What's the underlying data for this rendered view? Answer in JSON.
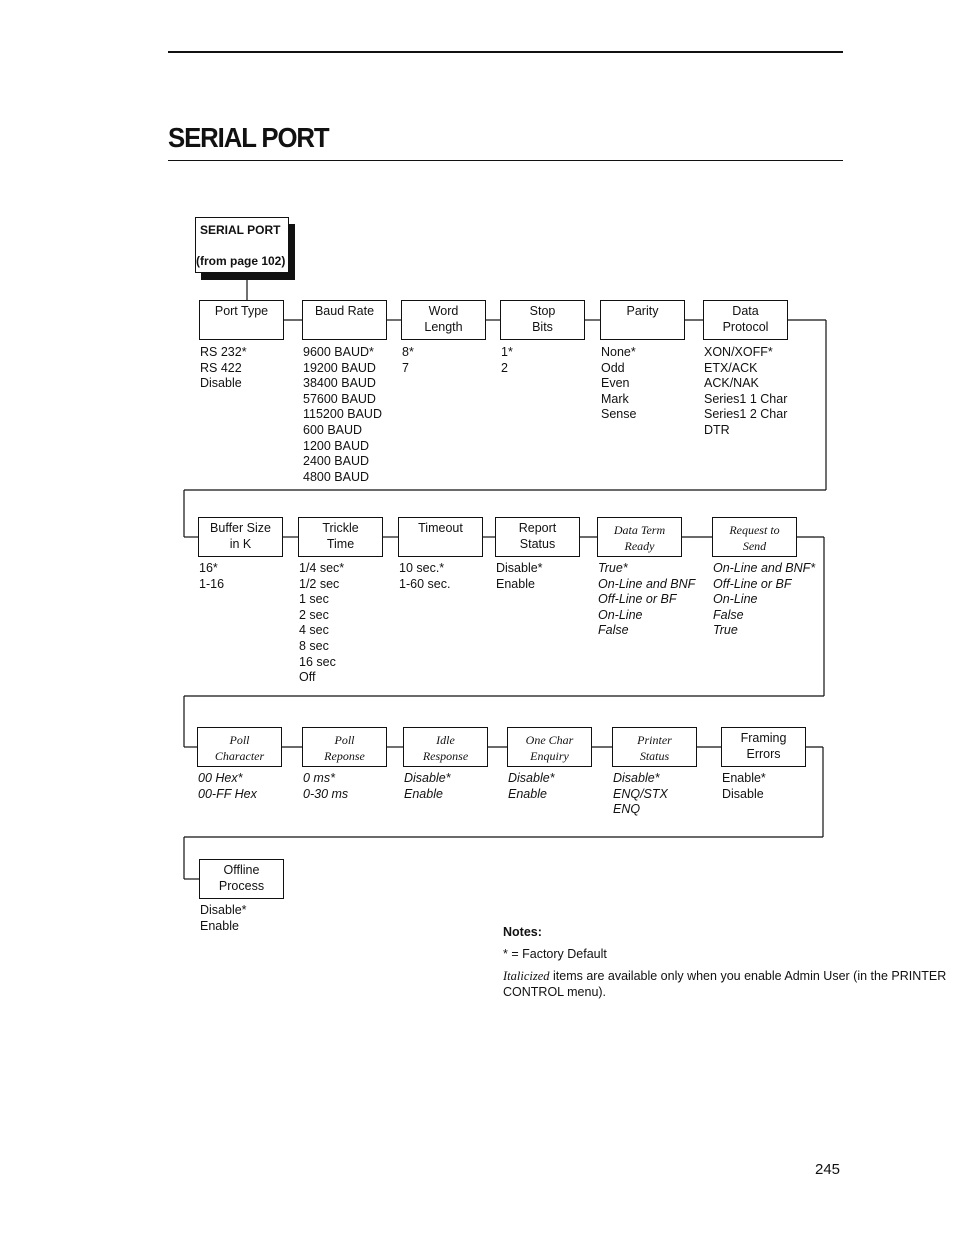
{
  "page": {
    "title": "SERIAL PORT",
    "page_number": "245"
  },
  "root": {
    "title": "SERIAL PORT",
    "subtitle": "(from page 102)"
  },
  "rows": [
    {
      "items": [
        {
          "label": [
            "Port Type"
          ],
          "italic": false,
          "options": [
            "RS 232*",
            "RS 422",
            "Disable"
          ],
          "options_italic": false
        },
        {
          "label": [
            "Baud Rate"
          ],
          "italic": false,
          "options": [
            "9600 BAUD*",
            "19200 BAUD",
            "38400 BAUD",
            "57600 BAUD",
            "115200 BAUD",
            "600 BAUD",
            "1200 BAUD",
            "2400 BAUD",
            "4800 BAUD"
          ],
          "options_italic": false
        },
        {
          "label": [
            "Word",
            "Length"
          ],
          "italic": false,
          "options": [
            "8*",
            "7"
          ],
          "options_italic": false
        },
        {
          "label": [
            "Stop",
            "Bits"
          ],
          "italic": false,
          "options": [
            "1*",
            "2"
          ],
          "options_italic": false
        },
        {
          "label": [
            "Parity"
          ],
          "italic": false,
          "options": [
            "None*",
            "Odd",
            "Even",
            "Mark",
            "Sense"
          ],
          "options_italic": false
        },
        {
          "label": [
            "Data",
            "Protocol"
          ],
          "italic": false,
          "options": [
            "XON/XOFF*",
            "ETX/ACK",
            "ACK/NAK",
            "Series1 1 Char",
            "Series1 2 Char",
            "DTR"
          ],
          "options_italic": false
        }
      ]
    },
    {
      "items": [
        {
          "label": [
            "Buffer Size",
            "in K"
          ],
          "italic": false,
          "options": [
            "16*",
            "1-16"
          ],
          "options_italic": false
        },
        {
          "label": [
            "Trickle",
            "Time"
          ],
          "italic": false,
          "options": [
            "1/4 sec*",
            "1/2 sec",
            "1 sec",
            "2 sec",
            "4 sec",
            "8 sec",
            "16 sec",
            "Off"
          ],
          "options_italic": false
        },
        {
          "label": [
            "Timeout"
          ],
          "italic": false,
          "options": [
            "10 sec.*",
            "1-60 sec."
          ],
          "options_italic": false
        },
        {
          "label": [
            "Report",
            "Status"
          ],
          "italic": false,
          "options": [
            "Disable*",
            "Enable"
          ],
          "options_italic": false
        },
        {
          "label": [
            "Data Term",
            "Ready"
          ],
          "italic": true,
          "options": [
            "True*",
            "On-Line and BNF",
            "Off-Line or BF",
            "On-Line",
            "False"
          ],
          "options_italic": true
        },
        {
          "label": [
            "Request to",
            "Send"
          ],
          "italic": true,
          "options": [
            "On-Line and BNF*",
            "Off-Line or BF",
            "On-Line",
            "False",
            "True"
          ],
          "options_italic": true
        }
      ]
    },
    {
      "items": [
        {
          "label": [
            "Poll",
            "Character"
          ],
          "italic": true,
          "options": [
            "00 Hex*",
            "00-FF Hex"
          ],
          "options_italic": true
        },
        {
          "label": [
            "Poll",
            "Reponse"
          ],
          "italic": true,
          "options": [
            "0 ms*",
            "0-30 ms"
          ],
          "options_italic": true
        },
        {
          "label": [
            "Idle",
            "Response"
          ],
          "italic": true,
          "options": [
            "Disable*",
            "Enable"
          ],
          "options_italic": true
        },
        {
          "label": [
            "One Char",
            "Enquiry"
          ],
          "italic": true,
          "options": [
            "Disable*",
            "Enable"
          ],
          "options_italic": true
        },
        {
          "label": [
            "Printer",
            "Status"
          ],
          "italic": true,
          "options": [
            "Disable*",
            "ENQ/STX",
            "ENQ"
          ],
          "options_italic": true
        },
        {
          "label": [
            "Framing",
            "Errors"
          ],
          "italic": false,
          "options": [
            "Enable*",
            "Disable"
          ],
          "options_italic": false
        }
      ]
    },
    {
      "items": [
        {
          "label": [
            "Offline",
            "Process"
          ],
          "italic": false,
          "options": [
            "Disable*",
            "Enable"
          ],
          "options_italic": false
        }
      ]
    }
  ],
  "notes": {
    "title": "Notes:",
    "default_marker": "* = Factory Default",
    "italic_word": "Italicized",
    "italic_text": " items are available only when you enable Admin User (in the PRINTER CONTROL menu)."
  }
}
